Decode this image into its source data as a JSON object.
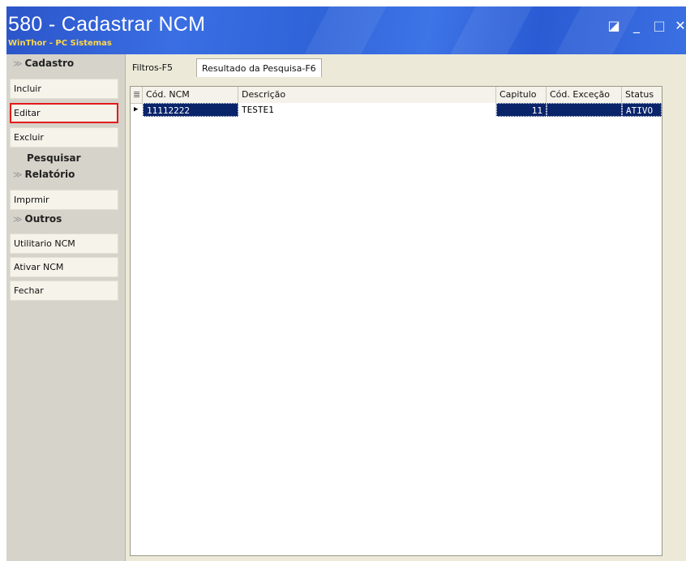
{
  "window": {
    "title": "580 - Cadastrar  NCM",
    "subtitle": "WinThor - PC Sistemas",
    "controls": {
      "restore": "◪",
      "minimize": "_",
      "maximize": "□",
      "close": "✕"
    }
  },
  "sidebar": {
    "cadastro": {
      "heading": "Cadastro",
      "items": [
        {
          "label": "Incluir"
        },
        {
          "label": "Editar",
          "selected": true
        },
        {
          "label": "Excluir"
        }
      ],
      "pesquisar": "Pesquisar"
    },
    "relatorio": {
      "heading": "Relatório",
      "items": [
        {
          "label": "Imprmir"
        }
      ]
    },
    "outros": {
      "heading": "Outros",
      "items": [
        {
          "label": "Utilitario NCM"
        },
        {
          "label": "Ativar NCM"
        },
        {
          "label": "Fechar"
        }
      ]
    },
    "chevron": "≫"
  },
  "tabs": [
    {
      "label": "Filtros-F5",
      "active": false
    },
    {
      "label": "Resultado da Pesquisa-F6",
      "active": true
    }
  ],
  "grid": {
    "headers": [
      "Cód. NCM",
      "Descrição",
      "Capitulo",
      "Cód. Exceção",
      "Status"
    ],
    "rows": [
      {
        "cod_ncm": "11112222",
        "descricao": "TESTE1",
        "capitulo": "11",
        "cod_excecao": "",
        "status": "ATIVO",
        "selected": true
      }
    ]
  },
  "colors": {
    "titlebar": "#2f63d8",
    "title_text": "#ffffff",
    "subtitle_text": "#ffd84a",
    "selection": "#0a246a",
    "highlight_border": "#e31b1b"
  }
}
